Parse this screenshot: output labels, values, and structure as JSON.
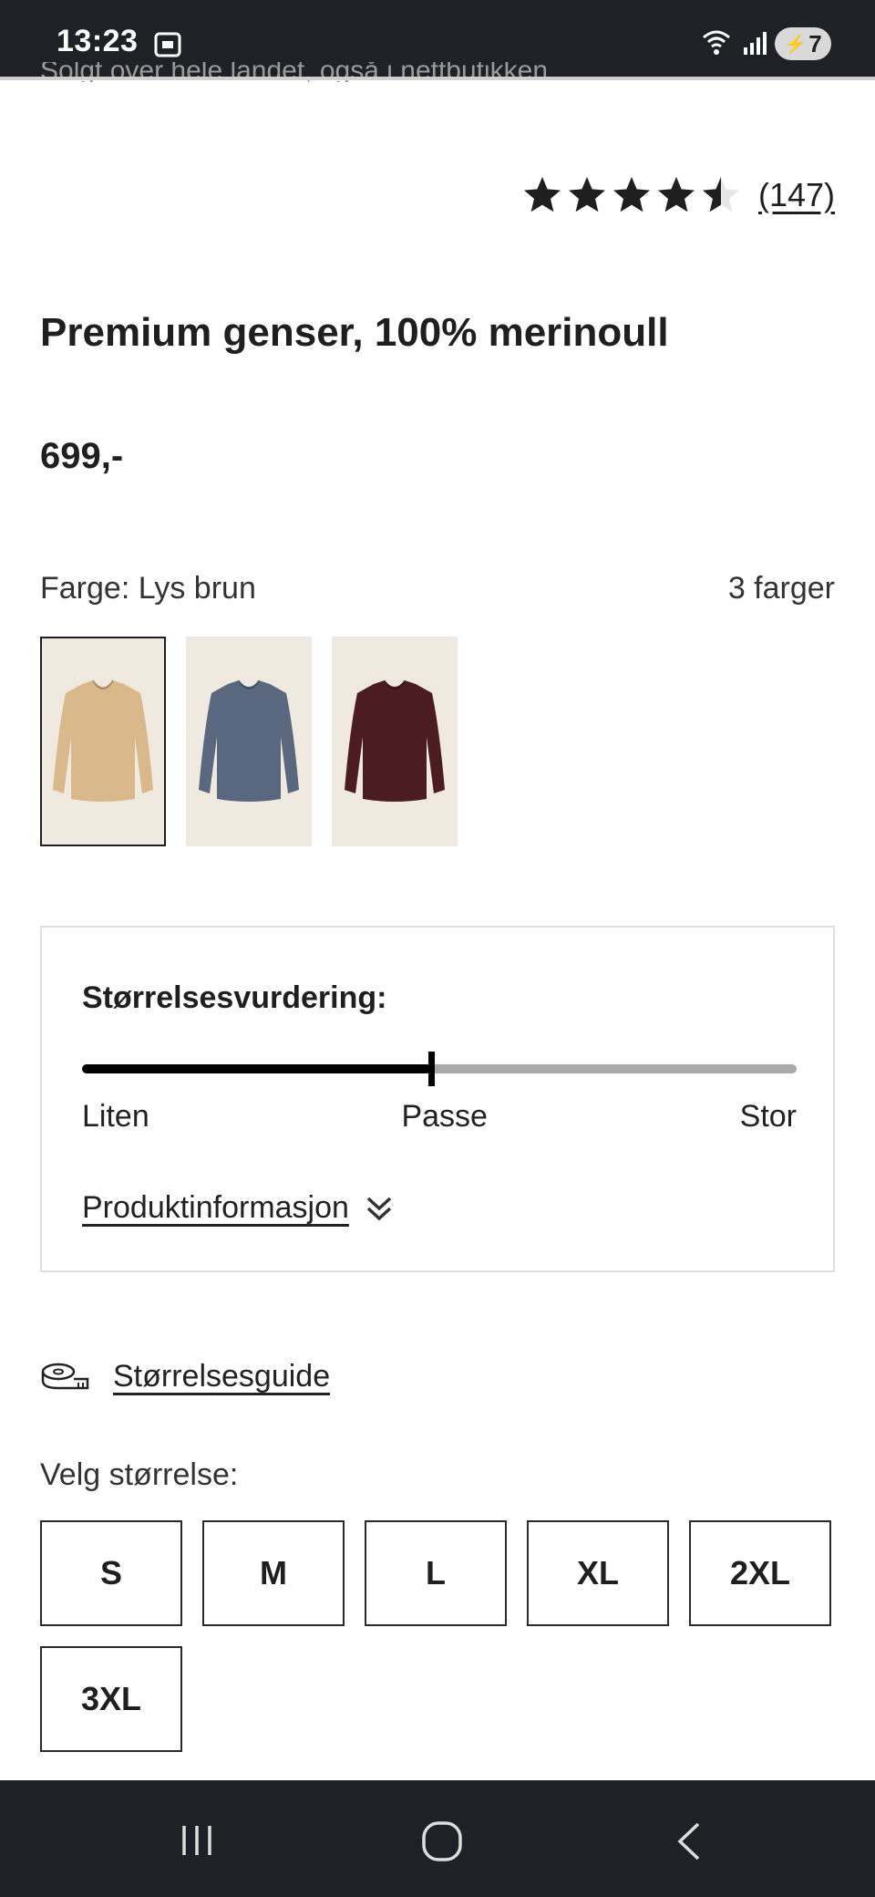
{
  "status_bar": {
    "time": "13:23",
    "battery_level": "7"
  },
  "partial_top_text": "Solgt over hele landet, også i nettbutikken",
  "rating": {
    "stars": 4.5,
    "max_stars": 5,
    "count": "(147)"
  },
  "product": {
    "title": "Premium genser, 100% merinoull",
    "price": "699,-"
  },
  "color": {
    "label": "Farge: Lys brun",
    "count": "3 farger",
    "swatches": [
      {
        "color": "#d9b98b",
        "selected": true
      },
      {
        "color": "#59677f",
        "selected": false
      },
      {
        "color": "#4b1c21",
        "selected": false
      }
    ]
  },
  "fit": {
    "title": "Størrelsesvurdering:",
    "value_fraction": 0.488,
    "labels": [
      "Liten",
      "Passe",
      "Stor"
    ],
    "info_link": "Produktinformasjon"
  },
  "size_guide": {
    "label": "Størrelsesguide"
  },
  "size_picker": {
    "label": "Velg størrelse:",
    "sizes": [
      "S",
      "M",
      "L",
      "XL",
      "2XL",
      "3XL"
    ]
  }
}
